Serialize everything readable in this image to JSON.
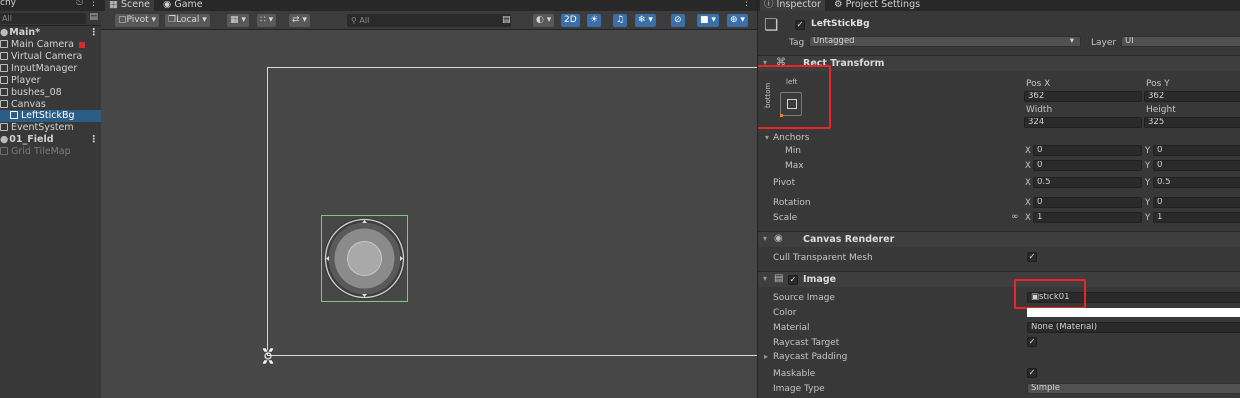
{
  "hierarchy": {
    "tab_label": "chy",
    "search_placeholder": "All",
    "items": [
      {
        "label": "Main*"
      },
      {
        "label": "Main Camera"
      },
      {
        "label": "Virtual Camera"
      },
      {
        "label": "InputManager"
      },
      {
        "label": "Player"
      },
      {
        "label": "bushes_08"
      },
      {
        "label": "Canvas"
      },
      {
        "label": "LeftStickBg"
      },
      {
        "label": "EventSystem"
      },
      {
        "label": "01_Field"
      },
      {
        "label": "Grid TileMap"
      }
    ]
  },
  "scene": {
    "tabs": [
      "Scene",
      "Game"
    ],
    "toolbar": {
      "pivot": "Pivot",
      "local": "Local",
      "search_placeholder": "All",
      "mode_2d": "2D"
    }
  },
  "inspector": {
    "tabs": [
      "Inspector",
      "Project Settings"
    ],
    "object_name": "LeftStickBg",
    "tag_label": "Tag",
    "tag_value": "Untagged",
    "layer_label": "Layer",
    "layer_value": "UI",
    "rect_transform": {
      "title": "Rect Transform",
      "anchor_h": "left",
      "anchor_v": "bottom",
      "pos_x_label": "Pos X",
      "pos_y_label": "Pos Y",
      "pos_x": "362",
      "pos_y": "362",
      "width_label": "Width",
      "height_label": "Height",
      "width": "324",
      "height": "325",
      "anchors_label": "Anchors",
      "min_label": "Min",
      "max_label": "Max",
      "min_x": "0",
      "min_y": "0",
      "max_x": "0",
      "max_y": "0",
      "pivot_label": "Pivot",
      "pivot_x": "0.5",
      "pivot_y": "0.5",
      "rotation_label": "Rotation",
      "rot_x": "0",
      "rot_y": "0",
      "scale_label": "Scale",
      "scale_x": "1",
      "scale_y": "1"
    },
    "canvas_renderer": {
      "title": "Canvas Renderer",
      "cull_label": "Cull Transparent Mesh"
    },
    "image": {
      "title": "Image",
      "source_label": "Source Image",
      "source_value": "stick01",
      "color_label": "Color",
      "material_label": "Material",
      "material_value": "None (Material)",
      "raycast_target_label": "Raycast Target",
      "raycast_padding_label": "Raycast Padding",
      "maskable_label": "Maskable",
      "image_type_label": "Image Type",
      "image_type_value": "Simple"
    },
    "axis": {
      "x": "X",
      "y": "Y"
    }
  }
}
